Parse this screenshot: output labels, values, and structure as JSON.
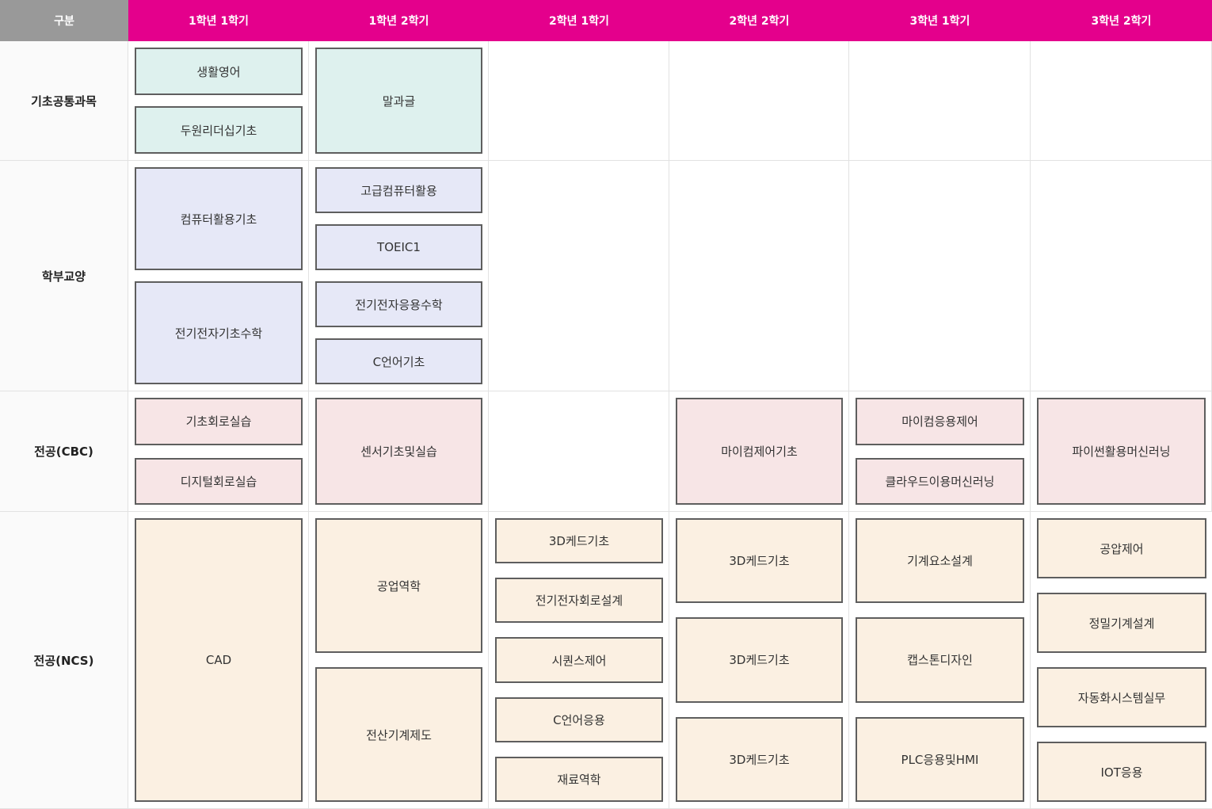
{
  "header": [
    "구분",
    "1학년 1학기",
    "1학년 2학기",
    "2학년 1학기",
    "2학년 2학기",
    "3학년 1학기",
    "3학년 2학기"
  ],
  "rows": [
    {
      "label": "기초공통과목",
      "color": "#def1ee",
      "cells": [
        [
          "생활영어",
          "두원리더십기초"
        ],
        [
          "말과글"
        ],
        [],
        [],
        [],
        []
      ]
    },
    {
      "label": "학부교양",
      "color": "#e6e8f7",
      "cells": [
        [
          "컴퓨터활용기초",
          "전기전자기초수학"
        ],
        [
          "고급컴퓨터활용",
          "TOEIC1",
          "전기전자응용수학",
          "C언어기초"
        ],
        [],
        [],
        [],
        []
      ]
    },
    {
      "label": "전공(CBC)",
      "color": "#f7e5e6",
      "cells": [
        [
          "기초회로실습",
          "디지털회로실습"
        ],
        [
          "센서기초및실습"
        ],
        [],
        [
          "마이컴제어기초"
        ],
        [
          "마이컴응용제어",
          "클라우드이용머신러닝"
        ],
        [
          "파이썬활용머신러닝"
        ]
      ]
    },
    {
      "label": "전공(NCS)",
      "color": "#fbf0e2",
      "cells": [
        [
          "CAD"
        ],
        [
          "공업역학",
          "전산기계제도"
        ],
        [
          "3D케드기초",
          "전기전자회로설계",
          "시퀀스제어",
          "C언어응용",
          "재료역학"
        ],
        [
          "3D케드기초",
          "3D케드기초",
          "3D케드기초"
        ],
        [
          "기계요소설계",
          "캡스톤디자인",
          "PLC응용및HMI"
        ],
        [
          "공압제어",
          "정밀기계설계",
          "자동화시스템실무",
          "IOT응용"
        ]
      ]
    }
  ]
}
